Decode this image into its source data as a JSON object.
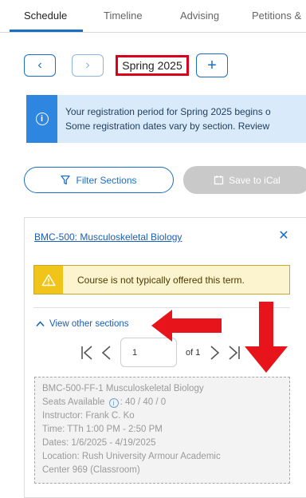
{
  "tabs": [
    {
      "label": "Schedule",
      "active": true
    },
    {
      "label": "Timeline",
      "active": false
    },
    {
      "label": "Advising",
      "active": false
    },
    {
      "label": "Petitions &",
      "active": false
    }
  ],
  "term": {
    "prev_icon": "chevron-left-icon",
    "next_icon": "chevron-right-icon",
    "current": "Spring 2025",
    "add_icon": "plus-icon"
  },
  "banner": {
    "line1": "Your registration period for Spring 2025 begins o",
    "line2": "Some registration dates vary by section. Review",
    "icon": "info-icon",
    "color": "#2f86e0"
  },
  "actions": {
    "filter_label": "Filter Sections",
    "filter_icon": "funnel-icon",
    "ical_label": "Save to iCal",
    "ical_icon": "calendar-icon"
  },
  "course": {
    "title": "BMC-500: Musculoskeletal Biology",
    "close_icon": "close-icon",
    "warning": "Course is not typically offered this term.",
    "warning_icon": "warning-icon",
    "warning_color": "#f0c419",
    "view_other": "View other sections"
  },
  "pager": {
    "current_page": "1",
    "of_label": "of 1"
  },
  "section": {
    "title": "BMC-500-FF-1 Musculoskeletal Biology",
    "seats_label": "Seats Available",
    "seats_value": ": 40 / 40 / 0",
    "instructor": "Instructor: Frank C. Ko",
    "time": "Time: TTh 1:00 PM - 2:50 PM",
    "dates": "Dates: 1/6/2025 - 4/19/2025",
    "location1": "Location: Rush University Armour Academic",
    "location2": "Center 969 (Classroom)"
  },
  "annotation_color": "#e8141b"
}
